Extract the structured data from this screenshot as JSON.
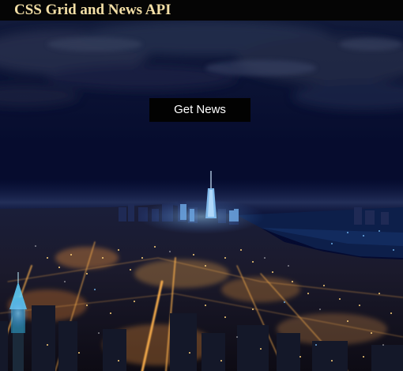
{
  "header": {
    "title": "CSS Grid and News API"
  },
  "hero": {
    "image": "night-city-skyline",
    "button_label": "Get News"
  },
  "colors": {
    "header_background": "#050505",
    "title_color": "#f3dfa6",
    "button_background": "#020202",
    "button_text": "#ffffff",
    "sky_top": "#0a1230",
    "sky_bottom": "#04082a",
    "city_light": "#ffb347"
  }
}
